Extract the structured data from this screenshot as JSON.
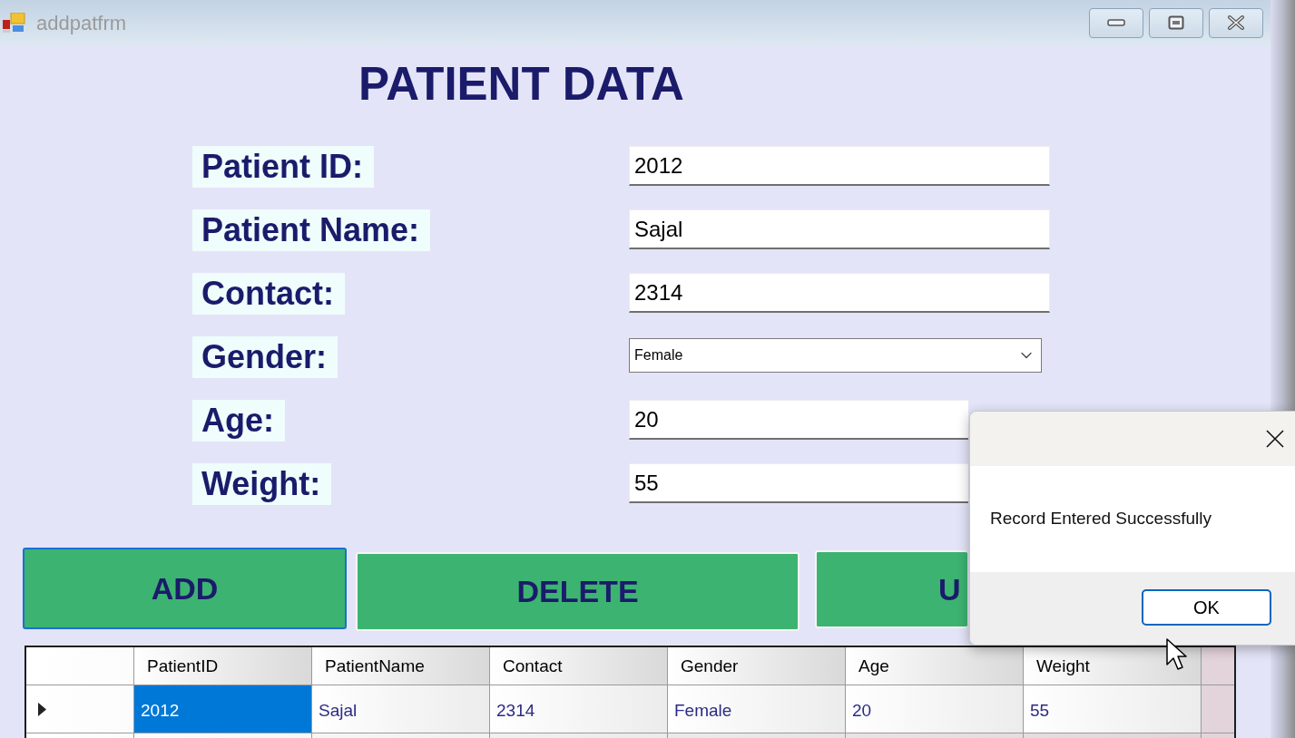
{
  "window": {
    "title": "addpatfrm"
  },
  "form": {
    "heading": "PATIENT DATA",
    "fields": [
      {
        "label": "Patient ID:",
        "kind": "text",
        "value": "2012"
      },
      {
        "label": "Patient Name:",
        "kind": "text",
        "value": "Sajal"
      },
      {
        "label": "Contact:",
        "kind": "text",
        "value": "2314"
      },
      {
        "label": "Gender:",
        "kind": "dropdown",
        "value": "Female"
      },
      {
        "label": "Age:",
        "kind": "text",
        "value": "20"
      },
      {
        "label": "Weight:",
        "kind": "text",
        "value": "55"
      }
    ]
  },
  "buttons": [
    {
      "label": "ADD",
      "focused": true
    },
    {
      "label": "DELETE",
      "focused": false
    },
    {
      "label": "U",
      "focused": false
    }
  ],
  "table": {
    "columns": [
      "PatientID",
      "PatientName",
      "Contact",
      "Gender",
      "Age",
      "Weight"
    ],
    "rows": [
      {
        "current": true,
        "cells": [
          {
            "text": "2012",
            "selected": true
          },
          {
            "text": "Sajal",
            "selected": false
          },
          {
            "text": "2314",
            "selected": false
          },
          {
            "text": "Female",
            "selected": false
          },
          {
            "text": "20",
            "selected": false
          },
          {
            "text": "55",
            "selected": false
          }
        ]
      }
    ]
  },
  "dialog": {
    "message": "Record Entered Successfully",
    "button": "OK"
  }
}
